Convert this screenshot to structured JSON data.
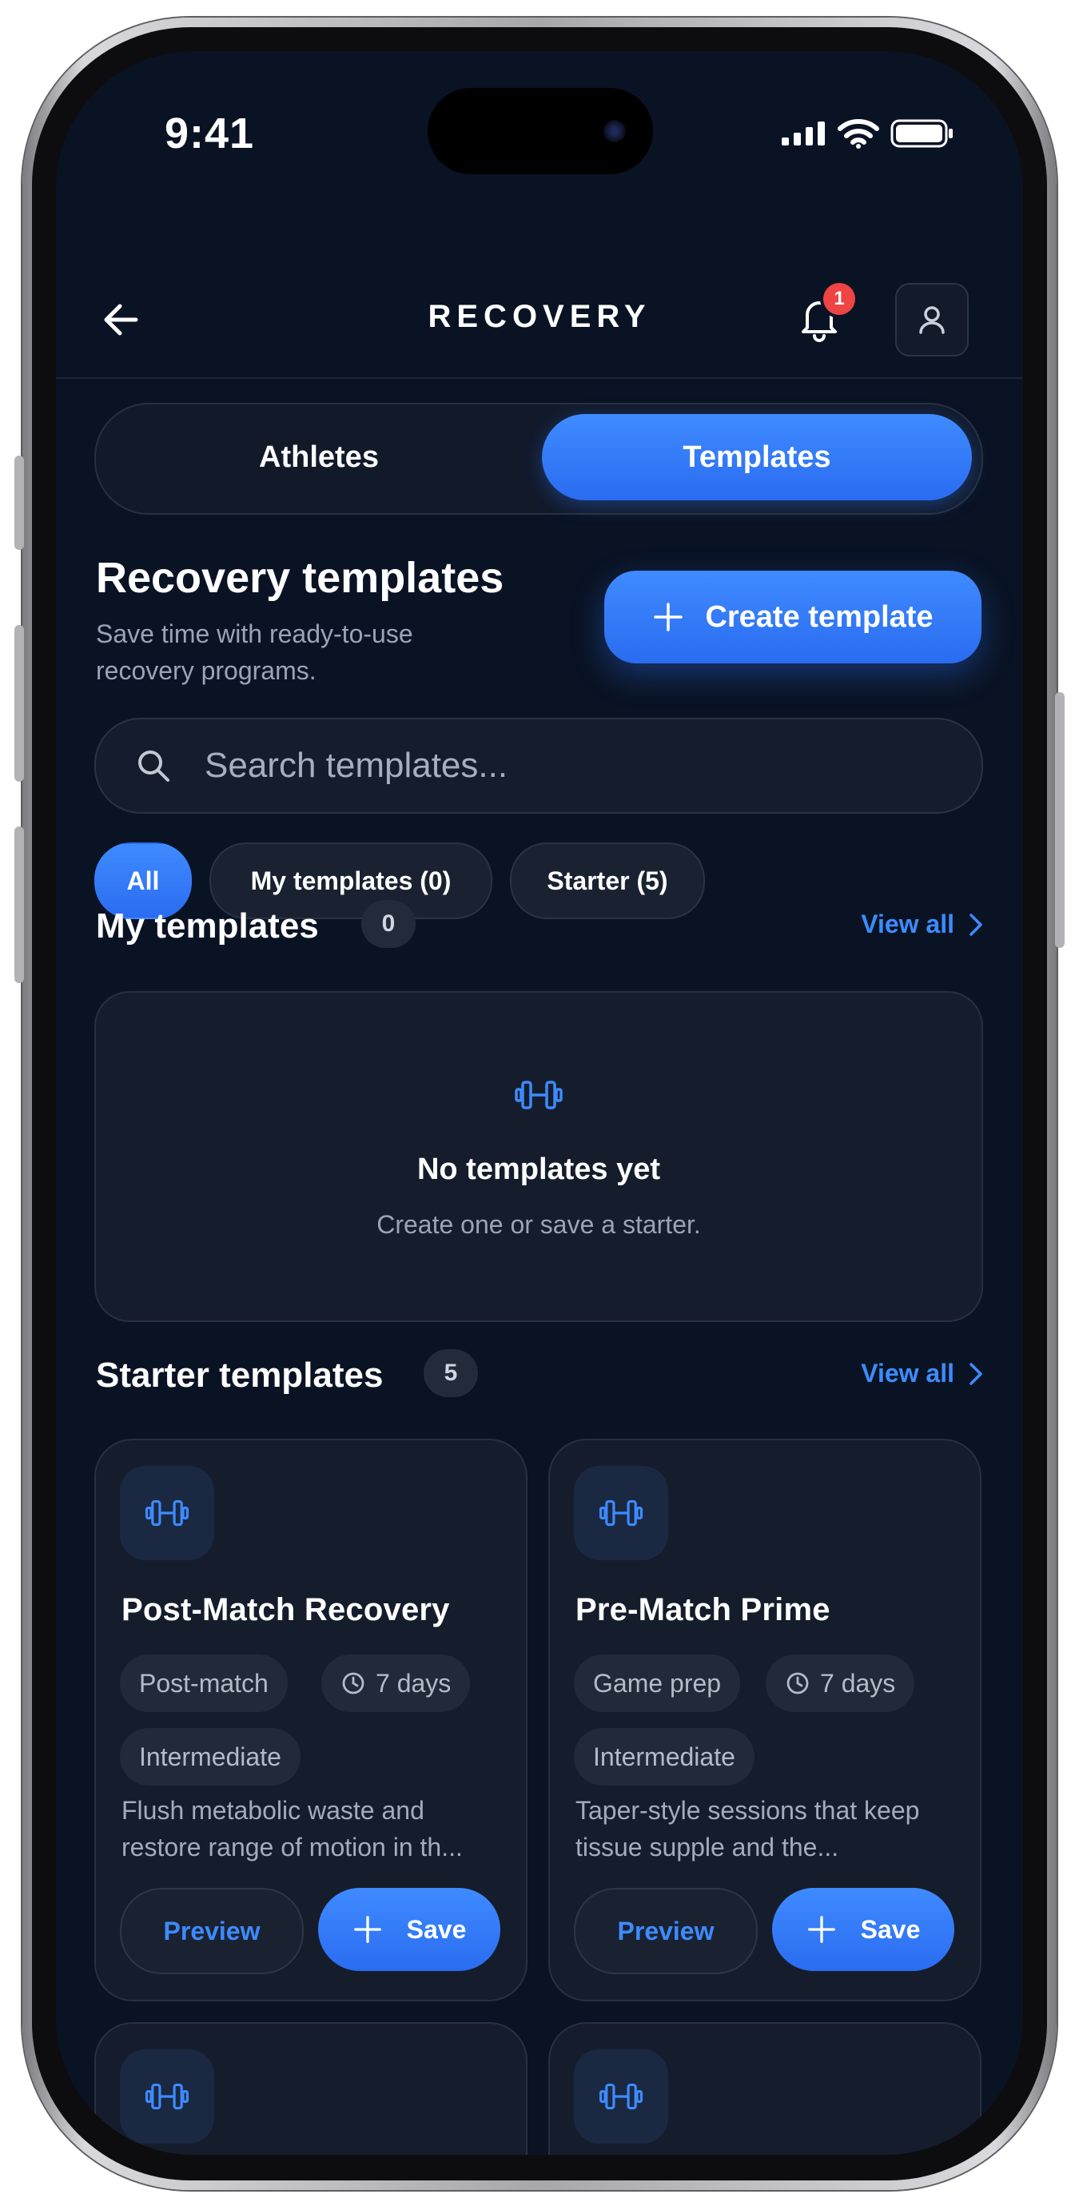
{
  "status": {
    "time": "9:41"
  },
  "header": {
    "title": "RECOVERY",
    "notification_count": "1"
  },
  "tabs": [
    {
      "label": "Athletes",
      "active": false
    },
    {
      "label": "Templates",
      "active": true
    }
  ],
  "page": {
    "title": "Recovery templates",
    "subtitle": "Save time with ready-to-use recovery programs.",
    "create_label": "Create template"
  },
  "search": {
    "placeholder": "Search templates..."
  },
  "filters": [
    {
      "label": "All",
      "active": true
    },
    {
      "label": "My templates (0)",
      "active": false
    },
    {
      "label": "Starter (5)",
      "active": false
    }
  ],
  "my_templates": {
    "title": "My templates",
    "count": "0",
    "view_all": "View all",
    "empty_title": "No templates yet",
    "empty_sub": "Create one or save a starter."
  },
  "starter_templates": {
    "title": "Starter templates",
    "count": "5",
    "view_all": "View all",
    "items": [
      {
        "title": "Post-Match Recovery",
        "category": "Post-match",
        "duration": "7 days",
        "level": "Intermediate",
        "description": "Flush metabolic waste and restore range of motion in th...",
        "preview_label": "Preview",
        "save_label": "Save"
      },
      {
        "title": "Pre-Match Prime",
        "category": "Game prep",
        "duration": "7 days",
        "level": "Intermediate",
        "description": "Taper-style sessions that keep tissue supple and the...",
        "preview_label": "Preview",
        "save_label": "Save"
      }
    ]
  },
  "colors": {
    "accent": "#2f7bff",
    "background": "#0a1324",
    "badge": "#ef4444"
  }
}
